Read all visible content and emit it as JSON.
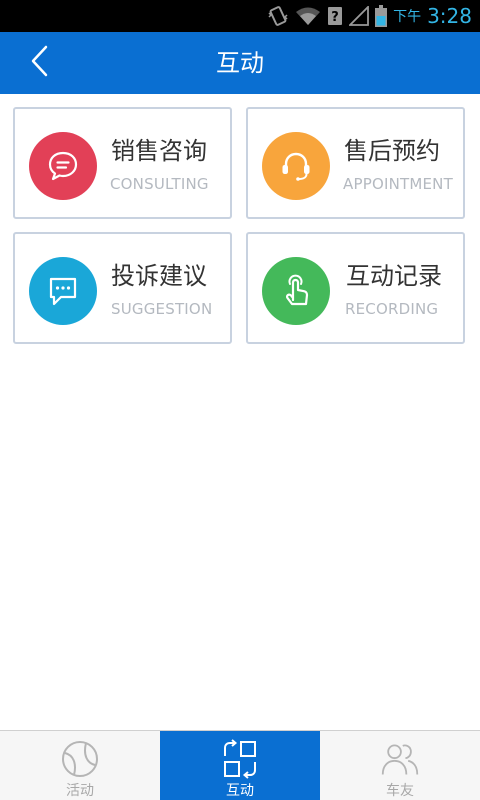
{
  "status_bar": {
    "ampm": "下午",
    "time": "3:28",
    "icons": [
      "vibrate-icon",
      "wifi-icon",
      "signal-icon",
      "battery-icon"
    ]
  },
  "header": {
    "title": "互动",
    "back_icon": "chevron-left-icon"
  },
  "cards": [
    {
      "title": "销售咨询",
      "subtitle": "CONSULTING",
      "icon": "chat-bubble-icon",
      "color": "#e24057"
    },
    {
      "title": "售后预约",
      "subtitle": "APPOINTMENT",
      "icon": "headset-icon",
      "color": "#f8a53c"
    },
    {
      "title": "投诉建议",
      "subtitle": "SUGGESTION",
      "icon": "comment-icon",
      "color": "#1aa7d8"
    },
    {
      "title": "互动记录",
      "subtitle": "RECORDING",
      "icon": "touch-hand-icon",
      "color": "#44b95a"
    }
  ],
  "bottom_nav": {
    "items": [
      {
        "label": "活动",
        "icon": "ball-icon",
        "active": false
      },
      {
        "label": "互动",
        "icon": "interact-icon",
        "active": true
      },
      {
        "label": "车友",
        "icon": "friends-icon",
        "active": false
      }
    ],
    "active_color": "#0a6fd2"
  }
}
